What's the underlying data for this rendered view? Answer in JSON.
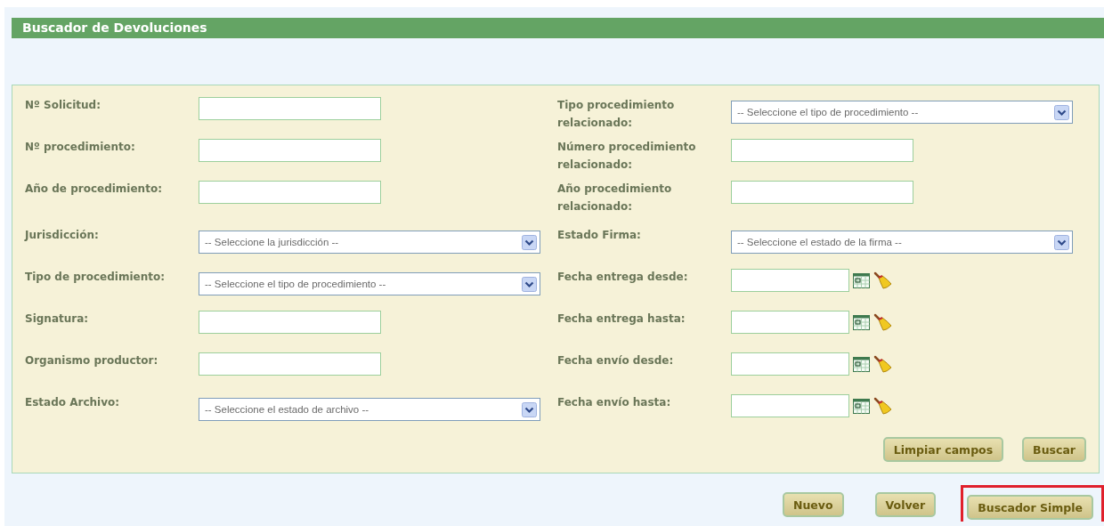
{
  "title": "Buscador de Devoluciones",
  "rows": [
    {
      "left": {
        "label": "Nº Solicitud:",
        "kind": "text"
      },
      "right": {
        "label": "Tipo procedimiento relacionado:",
        "kind": "select",
        "placeholder": "-- Seleccione el tipo de procedimiento --"
      }
    },
    {
      "left": {
        "label": "Nº procedimiento:",
        "kind": "text"
      },
      "right": {
        "label": "Número procedimiento relacionado:",
        "kind": "text"
      }
    },
    {
      "left": {
        "label": "Año de procedimiento:",
        "kind": "text"
      },
      "right": {
        "label": "Año procedimiento relacionado:",
        "kind": "text"
      }
    },
    {
      "left": {
        "label": "Jurisdicción:",
        "kind": "select",
        "placeholder": "-- Seleccione la jurisdicción --"
      },
      "right": {
        "label": "Estado Firma:",
        "kind": "select",
        "placeholder": "-- Seleccione el estado de la firma --"
      }
    },
    {
      "left": {
        "label": "Tipo de procedimiento:",
        "kind": "select",
        "placeholder": "-- Seleccione el tipo de procedimiento --"
      },
      "right": {
        "label": "Fecha entrega desde:",
        "kind": "date"
      }
    },
    {
      "left": {
        "label": "Signatura:",
        "kind": "text"
      },
      "right": {
        "label": "Fecha entrega hasta:",
        "kind": "date"
      }
    },
    {
      "left": {
        "label": "Organismo productor:",
        "kind": "text"
      },
      "right": {
        "label": "Fecha envío desde:",
        "kind": "date"
      }
    },
    {
      "left": {
        "label": "Estado Archivo:",
        "kind": "select",
        "placeholder": "-- Seleccione el estado de archivo --"
      },
      "right": {
        "label": "Fecha envío hasta:",
        "kind": "date"
      }
    }
  ],
  "form_buttons": [
    "Limpiar campos",
    "Buscar"
  ],
  "page_buttons": [
    {
      "label": "Nuevo",
      "highlighted": false
    },
    {
      "label": "Volver",
      "highlighted": false
    },
    {
      "label": "Buscador Simple",
      "highlighted": true
    }
  ]
}
